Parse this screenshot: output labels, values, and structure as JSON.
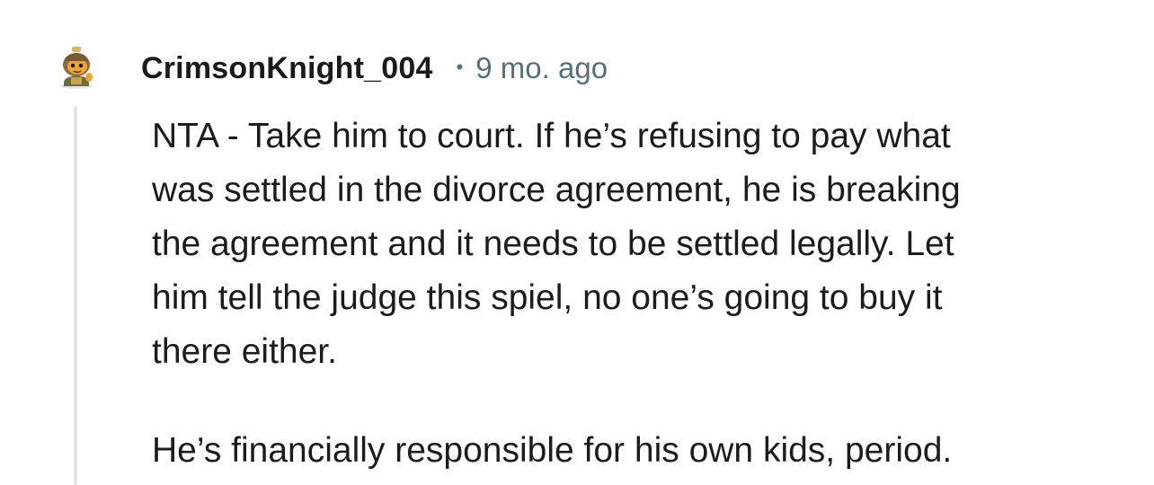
{
  "comment": {
    "author": "CrimsonKnight_004",
    "separator": "•",
    "timestamp": "9 mo. ago",
    "avatar_icon": "snoo-knight-avatar-icon",
    "paragraphs": [
      "NTA - Take him to court. If he’s refusing to pay what\nwas settled in the divorce agreement, he is breaking\nthe agreement and it needs to be settled legally. Let\nhim tell the judge this spiel, no one’s going to buy it\nthere either.",
      "He’s financially responsible for his own kids, period."
    ]
  },
  "colors": {
    "username": "#1a1a1b",
    "meta": "#576f76",
    "body": "#1c1c1c",
    "thread_line": "#e3e6e8"
  }
}
